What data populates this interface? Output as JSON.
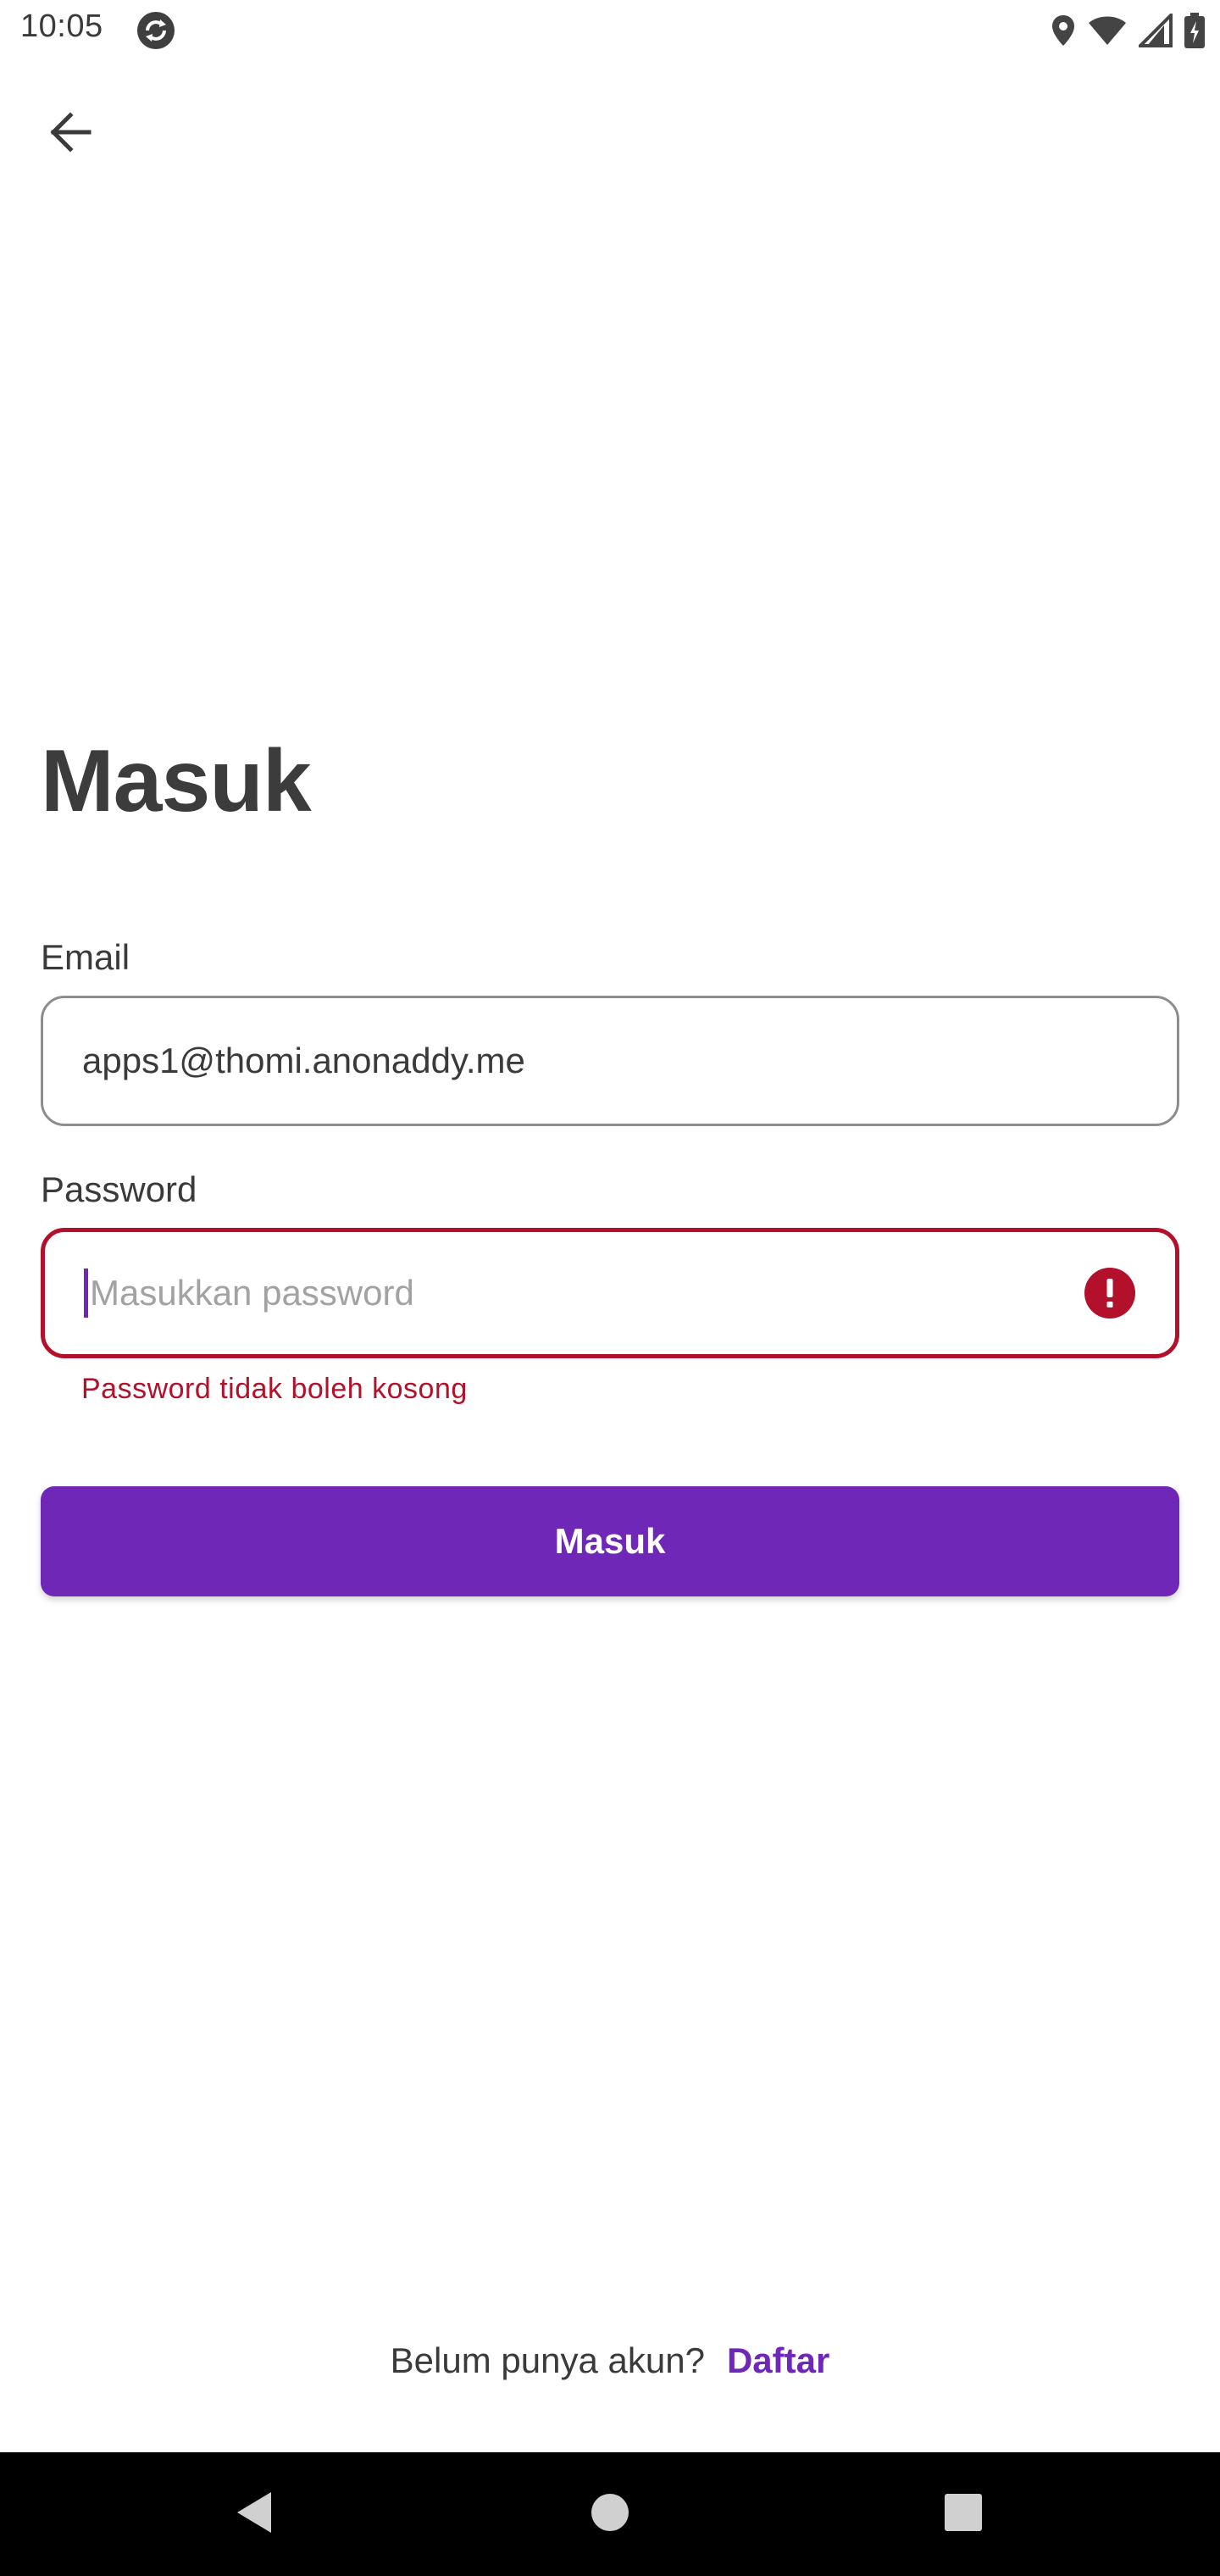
{
  "status_bar": {
    "time": "10:05",
    "icons": [
      "sync-icon",
      "location-icon",
      "wifi-icon",
      "signal-icon",
      "battery-icon"
    ]
  },
  "header": {
    "back_icon": "arrow-left-icon"
  },
  "page": {
    "title": "Masuk"
  },
  "form": {
    "email": {
      "label": "Email",
      "value": "apps1@thomi.anonaddy.me"
    },
    "password": {
      "label": "Password",
      "placeholder": "Masukkan password",
      "value": "",
      "error": "Password tidak boleh kosong",
      "error_icon": "error-icon"
    },
    "submit_label": "Masuk"
  },
  "footer": {
    "prompt": "Belum punya akun?",
    "link": "Daftar"
  },
  "nav_bar": {
    "buttons": [
      "back-triangle-icon",
      "home-circle-icon",
      "recents-square-icon"
    ]
  },
  "colors": {
    "accent": "#6E27B7",
    "error": "#B3102C",
    "text": "#3A3A3A",
    "border": "#8D8D8D"
  }
}
